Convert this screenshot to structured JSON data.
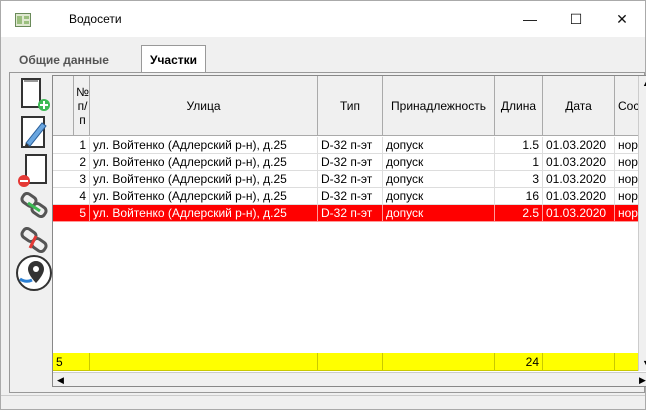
{
  "window": {
    "title": "Водосети",
    "minimize_glyph": "—",
    "maximize_glyph": "☐",
    "close_glyph": "✕"
  },
  "tabs": [
    {
      "label": "Общие данные",
      "active": false
    },
    {
      "label": "Участки",
      "active": true
    }
  ],
  "toolbar": {
    "icons": [
      "add-document-icon",
      "edit-document-icon",
      "remove-document-icon",
      "link-icon",
      "unlink-icon",
      "map-pin-icon"
    ]
  },
  "table": {
    "headers": {
      "num": "№ п/п",
      "street": "Улица",
      "type": "Тип",
      "owner": "Принадлежность",
      "length": "Длина",
      "date": "Дата",
      "state": "Сост"
    },
    "rows": [
      {
        "num": "1",
        "street": "ул. Войтенко (Адлерский р-н), д.25",
        "type": "D-32 п-эт",
        "owner": "допуск",
        "length": "1.5",
        "date": "01.03.2020",
        "state": "нор"
      },
      {
        "num": "2",
        "street": "ул. Войтенко (Адлерский р-н), д.25",
        "type": "D-32 п-эт",
        "owner": "допуск",
        "length": "1",
        "date": "01.03.2020",
        "state": "нор"
      },
      {
        "num": "3",
        "street": "ул. Войтенко (Адлерский р-н), д.25",
        "type": "D-32 п-эт",
        "owner": "допуск",
        "length": "3",
        "date": "01.03.2020",
        "state": "нор"
      },
      {
        "num": "4",
        "street": "ул. Войтенко (Адлерский р-н), д.25",
        "type": "D-32 п-эт",
        "owner": "допуск",
        "length": "16",
        "date": "01.03.2020",
        "state": "нор"
      },
      {
        "num": "5",
        "street": "ул. Войтенко (Адлерский р-н), д.25",
        "type": "D-32 п-эт",
        "owner": "допуск",
        "length": "2.5",
        "date": "01.03.2020",
        "state": "нор",
        "selected": true
      }
    ],
    "totals": {
      "num": "5",
      "length": "24"
    }
  },
  "colors": {
    "selected_row": "#ff0000",
    "totals_row": "#ffff00"
  }
}
